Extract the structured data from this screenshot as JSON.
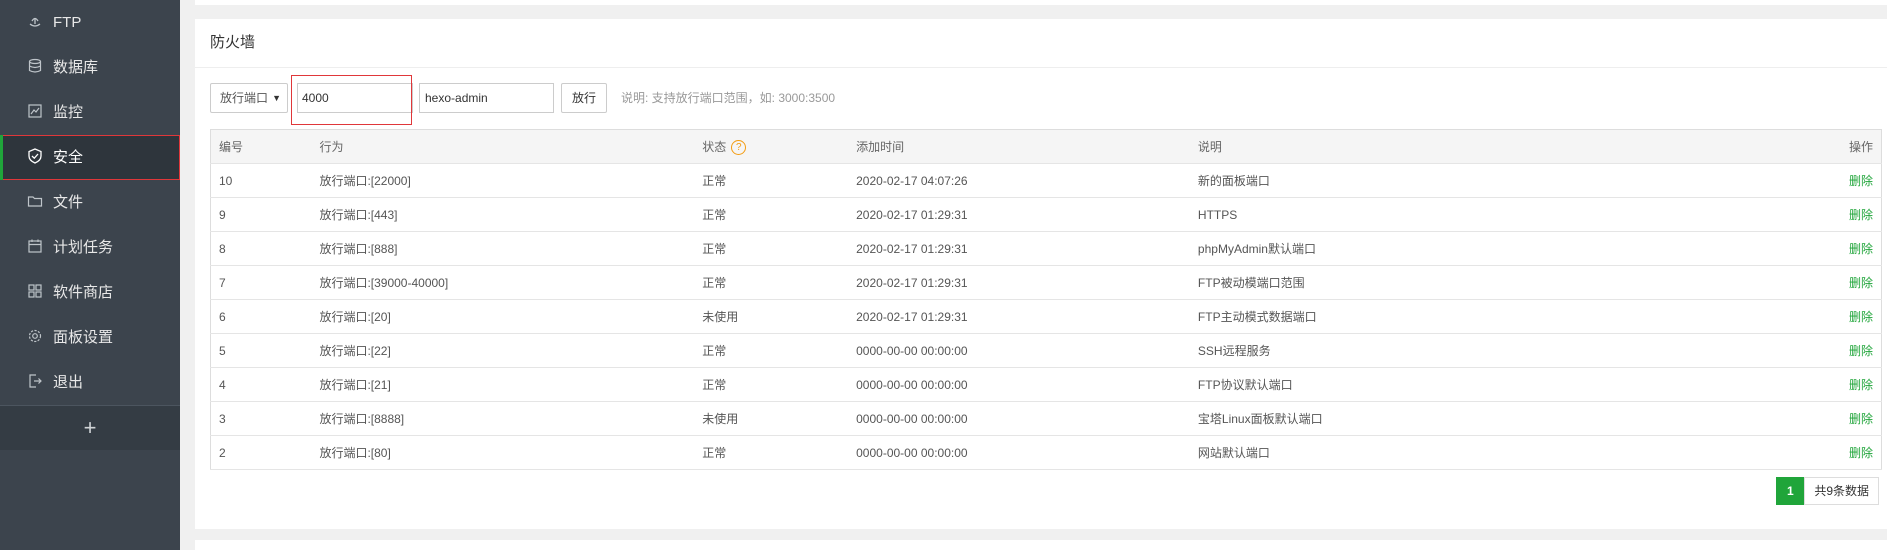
{
  "colors": {
    "sidebar_bg": "#3c444d",
    "accent_green": "#20a53a",
    "highlight_red": "#e0373a",
    "help_orange": "#f39c12"
  },
  "sidebar": {
    "items": [
      {
        "label": "FTP",
        "icon": "ftp-icon"
      },
      {
        "label": "数据库",
        "icon": "database-icon"
      },
      {
        "label": "监控",
        "icon": "monitor-icon"
      },
      {
        "label": "安全",
        "icon": "shield-icon",
        "active": true
      },
      {
        "label": "文件",
        "icon": "folder-icon"
      },
      {
        "label": "计划任务",
        "icon": "calendar-icon"
      },
      {
        "label": "软件商店",
        "icon": "grid-icon"
      },
      {
        "label": "面板设置",
        "icon": "gear-icon"
      },
      {
        "label": "退出",
        "icon": "logout-icon"
      }
    ],
    "add_label": "+"
  },
  "firewall": {
    "title": "防火墙",
    "select_value": "放行端口",
    "port_value": "4000",
    "note_value": "hexo-admin",
    "allow_button": "放行",
    "hint": "说明: 支持放行端口范围，如: 3000:3500",
    "columns": [
      "编号",
      "行为",
      "状态",
      "添加时间",
      "说明",
      "操作"
    ],
    "rows": [
      {
        "id": "10",
        "action": "放行端口:[22000]",
        "status": "正常",
        "time": "2020-02-17 04:07:26",
        "note": "新的面板端口",
        "op": "删除"
      },
      {
        "id": "9",
        "action": "放行端口:[443]",
        "status": "正常",
        "time": "2020-02-17 01:29:31",
        "note": "HTTPS",
        "op": "删除"
      },
      {
        "id": "8",
        "action": "放行端口:[888]",
        "status": "正常",
        "time": "2020-02-17 01:29:31",
        "note": "phpMyAdmin默认端口",
        "op": "删除"
      },
      {
        "id": "7",
        "action": "放行端口:[39000-40000]",
        "status": "正常",
        "time": "2020-02-17 01:29:31",
        "note": "FTP被动模端口范围",
        "op": "删除"
      },
      {
        "id": "6",
        "action": "放行端口:[20]",
        "status": "未使用",
        "time": "2020-02-17 01:29:31",
        "note": "FTP主动模式数据端口",
        "op": "删除"
      },
      {
        "id": "5",
        "action": "放行端口:[22]",
        "status": "正常",
        "time": "0000-00-00 00:00:00",
        "note": "SSH远程服务",
        "op": "删除"
      },
      {
        "id": "4",
        "action": "放行端口:[21]",
        "status": "正常",
        "time": "0000-00-00 00:00:00",
        "note": "FTP协议默认端口",
        "op": "删除"
      },
      {
        "id": "3",
        "action": "放行端口:[8888]",
        "status": "未使用",
        "time": "0000-00-00 00:00:00",
        "note": "宝塔Linux面板默认端口",
        "op": "删除"
      },
      {
        "id": "2",
        "action": "放行端口:[80]",
        "status": "正常",
        "time": "0000-00-00 00:00:00",
        "note": "网站默认端口",
        "op": "删除"
      }
    ],
    "pager": {
      "current": "1",
      "total": "共9条数据"
    }
  }
}
